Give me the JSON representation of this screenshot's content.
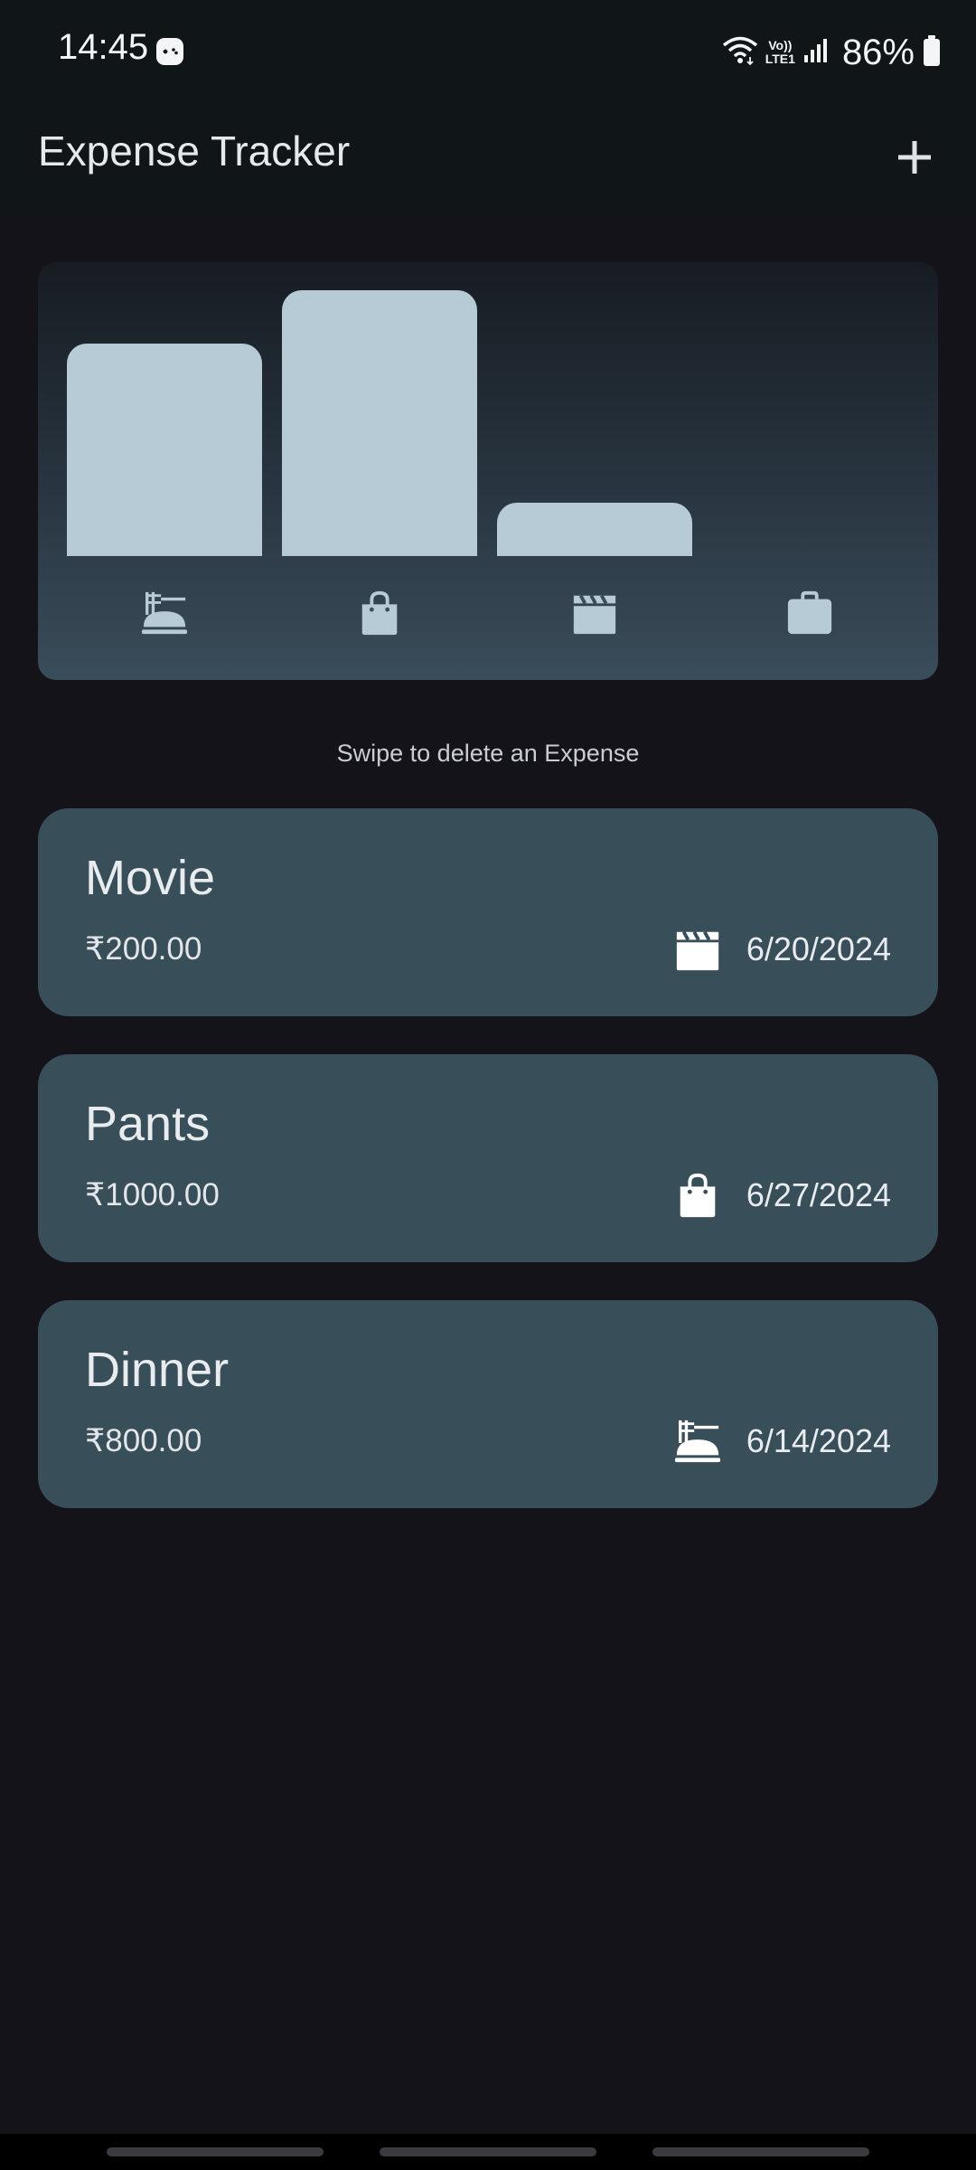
{
  "status_bar": {
    "time": "14:45",
    "network_label_top": "Vo))",
    "network_label_bottom": "LTE1",
    "battery": "86%"
  },
  "app_bar": {
    "title": "Expense Tracker",
    "add_icon": "plus-icon"
  },
  "chart_data": {
    "type": "bar",
    "categories": [
      "food",
      "leisure-shopping",
      "movie",
      "work"
    ],
    "category_icons": [
      "dinner-icon",
      "shopping-bag-icon",
      "clapperboard-icon",
      "briefcase-icon"
    ],
    "values": [
      800,
      1000,
      200,
      0
    ],
    "ylim": [
      0,
      1000
    ],
    "bar_color": "#b7cbd6"
  },
  "hint": "Swipe to delete an Expense",
  "expenses": [
    {
      "title": "Movie",
      "amount": "₹200.00",
      "icon": "clapperboard-icon",
      "date": "6/20/2024"
    },
    {
      "title": "Pants",
      "amount": "₹1000.00",
      "icon": "shopping-bag-icon",
      "date": "6/27/2024"
    },
    {
      "title": "Dinner",
      "amount": "₹800.00",
      "icon": "dinner-icon",
      "date": "6/14/2024"
    }
  ],
  "colors": {
    "background": "#15131a",
    "app_bar": "#101518",
    "card": "#384e59",
    "bar": "#b7cbd6"
  }
}
